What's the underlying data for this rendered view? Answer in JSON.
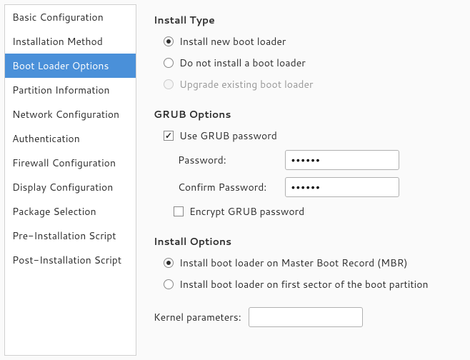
{
  "sidebar": {
    "items": [
      {
        "label": "Basic Configuration",
        "active": false
      },
      {
        "label": "Installation Method",
        "active": false
      },
      {
        "label": "Boot Loader Options",
        "active": true
      },
      {
        "label": "Partition Information",
        "active": false
      },
      {
        "label": "Network Configuration",
        "active": false
      },
      {
        "label": "Authentication",
        "active": false
      },
      {
        "label": "Firewall Configuration",
        "active": false
      },
      {
        "label": "Display Configuration",
        "active": false
      },
      {
        "label": "Package Selection",
        "active": false
      },
      {
        "label": "Pre-Installation Script",
        "active": false
      },
      {
        "label": "Post-Installation Script",
        "active": false
      }
    ]
  },
  "install_type": {
    "title": "Install Type",
    "options": [
      {
        "label": "Install new boot loader",
        "checked": true,
        "disabled": false
      },
      {
        "label": "Do not install a boot loader",
        "checked": false,
        "disabled": false
      },
      {
        "label": "Upgrade existing boot loader",
        "checked": false,
        "disabled": true
      }
    ]
  },
  "grub_options": {
    "title": "GRUB Options",
    "use_password": {
      "label": "Use GRUB password",
      "checked": true
    },
    "password_label": "Password:",
    "password_value": "••••••",
    "confirm_label": "Confirm Password:",
    "confirm_value": "••••••",
    "encrypt": {
      "label": "Encrypt GRUB password",
      "checked": false
    }
  },
  "install_options": {
    "title": "Install Options",
    "options": [
      {
        "label": "Install boot loader on Master Boot Record (MBR)",
        "checked": true
      },
      {
        "label": "Install boot loader on first sector of the boot partition",
        "checked": false
      }
    ]
  },
  "kernel": {
    "label": "Kernel parameters:",
    "value": ""
  }
}
